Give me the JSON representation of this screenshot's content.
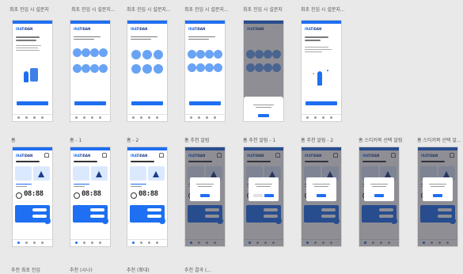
{
  "row1_titles": [
    "최초 진입 시 설문지",
    "최초 진입 시 설문지...",
    "최초 진입 시 설문지...",
    "최초 진입 시 설문지...",
    "최초 진입 시 설문지",
    "최초 진입 시 설문지..."
  ],
  "row2_titles": [
    "홈",
    "홈 - 1",
    "홈 - 2",
    "홈 추천 알림",
    "홈 추천 알림 - 1",
    "홈 추천 알림 - 2",
    "홈 스티커북 선택 알림",
    "홈 스티커북 선택 알..."
  ],
  "row3_titles": [
    "추천 최초 진입",
    "추천 (시나)",
    "추천 (확대)",
    "추천 결과 (..."
  ],
  "app": {
    "logo_a": "IRA",
    "logo_b": "TIDAN",
    "clock": "08:88"
  },
  "colors": {
    "primary": "#1e6ff1",
    "background": "#e9e9e9",
    "light_blue": "#69a3f5",
    "overlay": "rgba(50,50,60,0.55)"
  }
}
